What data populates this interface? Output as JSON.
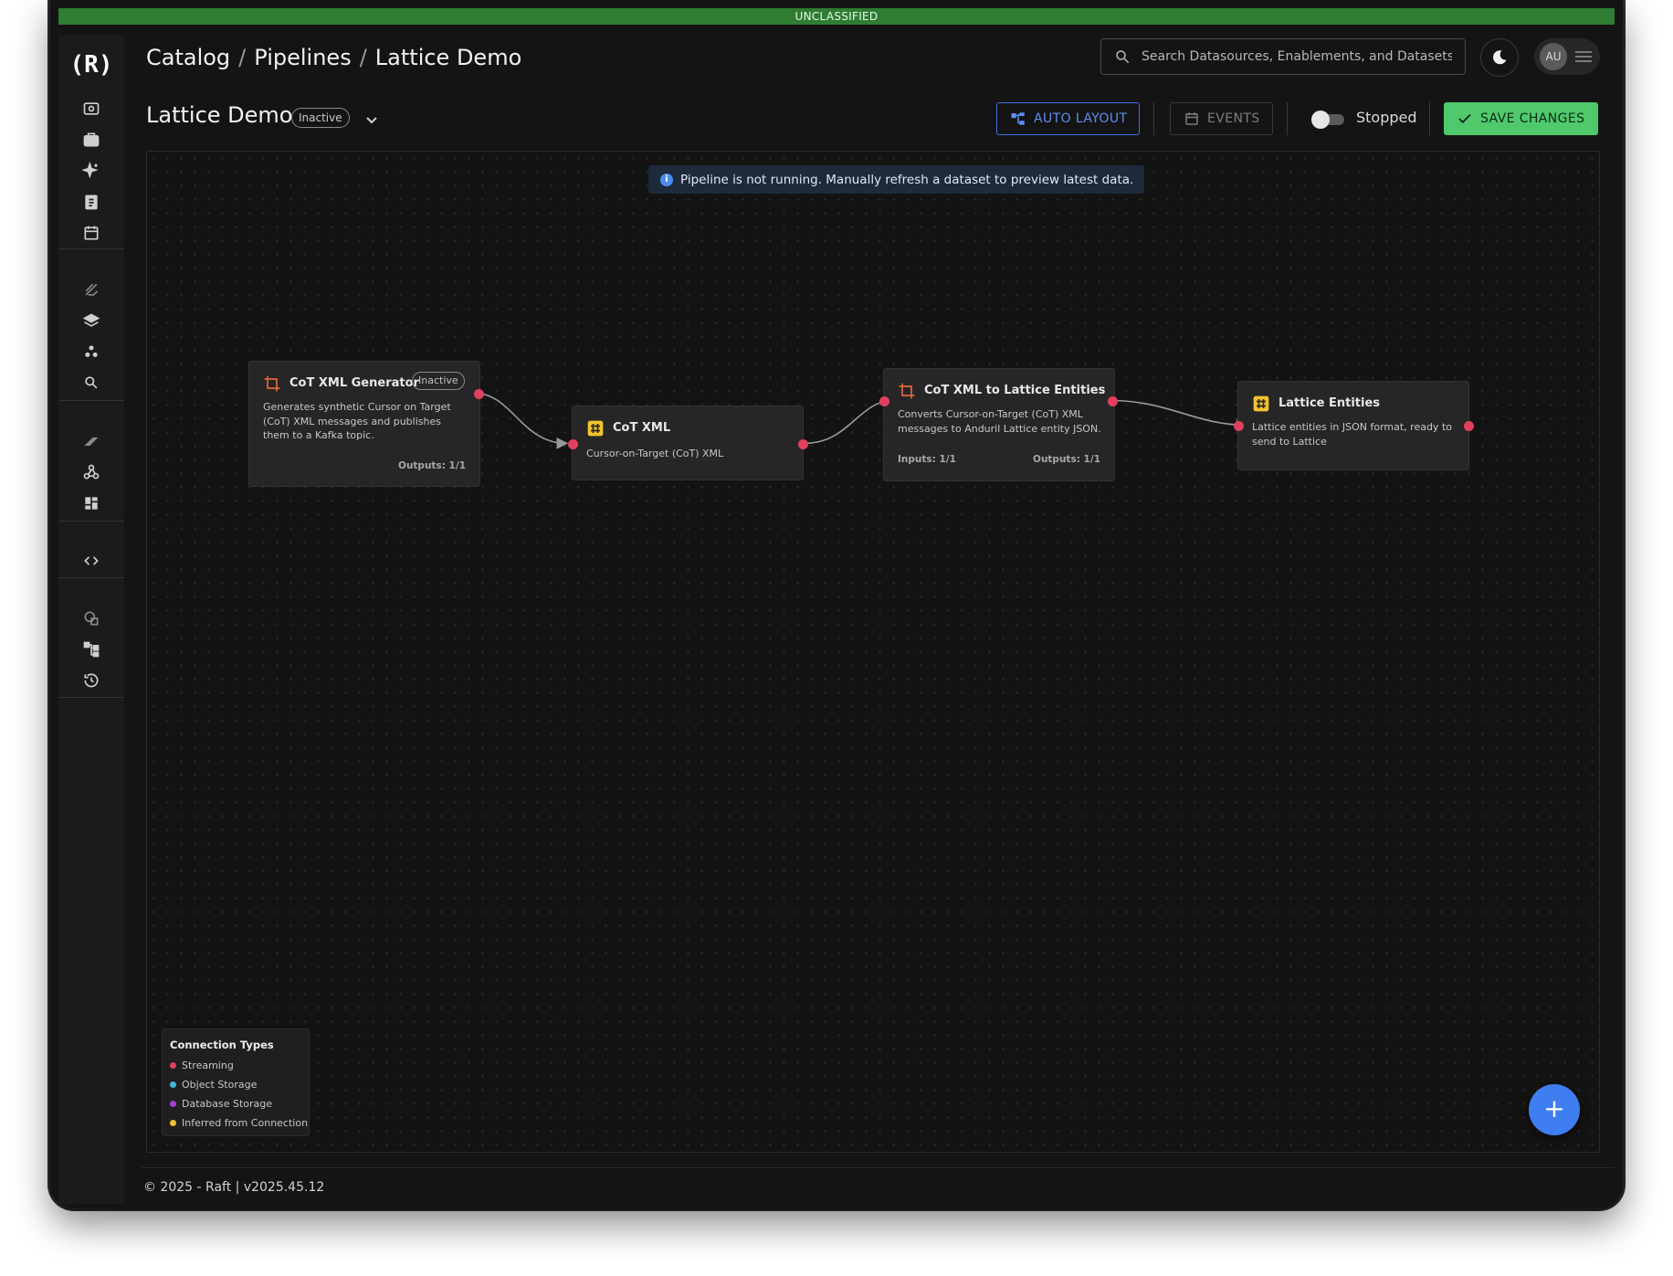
{
  "classification_banner": "UNCLASSIFIED",
  "logo": "(R)",
  "breadcrumb": [
    "Catalog",
    "Pipelines",
    "Lattice Demo"
  ],
  "breadcrumb_separator": "/",
  "search": {
    "placeholder": "Search Datasources, Enablements, and Datasets"
  },
  "user": {
    "initials": "AU"
  },
  "pipeline": {
    "title": "Lattice Demo",
    "status": "Inactive"
  },
  "toolbar": {
    "auto_layout_label": "AUTO LAYOUT",
    "events_label": "EVENTS",
    "run_state_label": "Stopped",
    "run_state_on": false,
    "save_label": "SAVE CHANGES"
  },
  "notice": "Pipeline is not running. Manually refresh a dataset to preview latest data.",
  "nodes": [
    {
      "title": "CoT XML Generator",
      "kind": "enablement",
      "status": "Inactive",
      "description": "Generates synthetic Cursor on Target (CoT) XML messages and publishes them to a Kafka topic.",
      "outputs": "Outputs: 1/1"
    },
    {
      "title": "CoT XML",
      "kind": "dataset",
      "description": "Cursor-on-Target (CoT) XML"
    },
    {
      "title": "CoT XML to Lattice Entities",
      "kind": "enablement",
      "description": "Converts Cursor-on-Target (CoT) XML messages to Anduril Lattice entity JSON.",
      "inputs": "Inputs: 1/1",
      "outputs": "Outputs: 1/1"
    },
    {
      "title": "Lattice Entities",
      "kind": "dataset",
      "description": "Lattice entities in JSON format, ready to send to Lattice"
    }
  ],
  "legend": {
    "title": "Connection Types",
    "items": [
      {
        "label": "Streaming",
        "color": "#e0405e"
      },
      {
        "label": "Object Storage",
        "color": "#3fb6d9"
      },
      {
        "label": "Database Storage",
        "color": "#a43fd0"
      },
      {
        "label": "Inferred from Connection",
        "color": "#f2c230"
      }
    ]
  },
  "fab_label": "+",
  "footer": "© 2025 - Raft  | v2025.45.12",
  "colors": {
    "banner": "#2e7d32",
    "accent_blue": "#3e6fe0",
    "save_green": "#4fc96b",
    "streaming_port": "#e0405e",
    "enablement_icon": "#e4673e",
    "dataset_icon": "#f2c230"
  }
}
